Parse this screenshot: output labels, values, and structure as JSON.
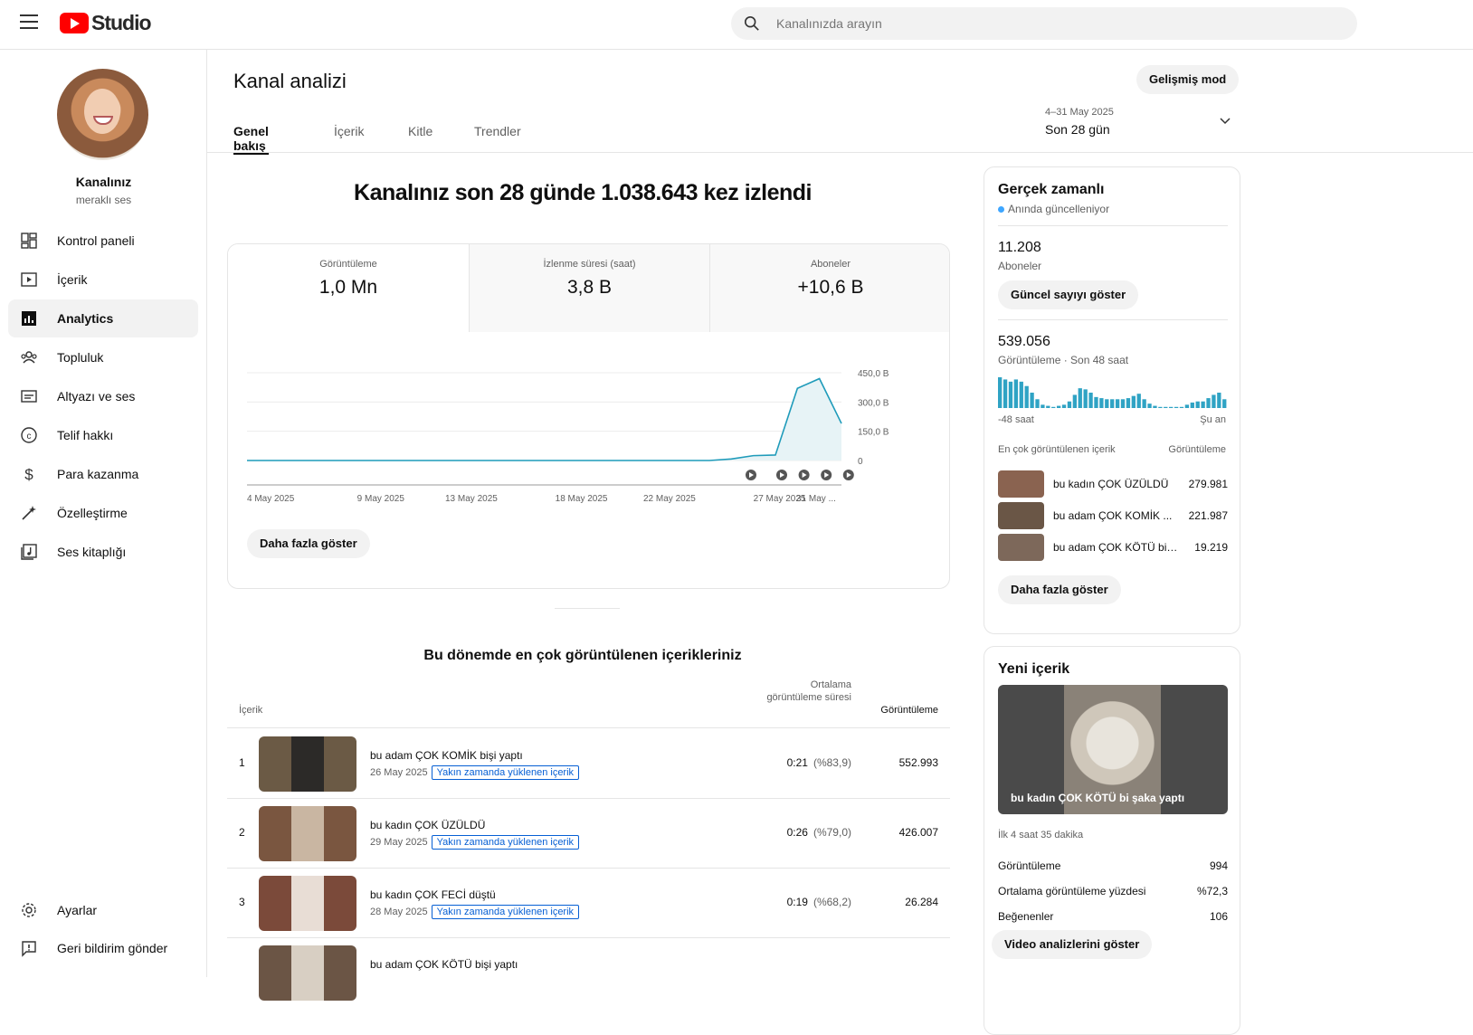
{
  "header": {
    "logo_text": "Studio",
    "search_placeholder": "Kanalınızda arayın"
  },
  "sidebar": {
    "channel_name": "Kanalınız",
    "channel_subtitle": "meraklı ses",
    "items": [
      {
        "label": "Kontrol paneli",
        "icon": "dashboard-icon"
      },
      {
        "label": "İçerik",
        "icon": "content-icon"
      },
      {
        "label": "Analytics",
        "icon": "analytics-icon"
      },
      {
        "label": "Topluluk",
        "icon": "community-icon"
      },
      {
        "label": "Altyazı ve ses",
        "icon": "subtitles-icon"
      },
      {
        "label": "Telif hakkı",
        "icon": "copyright-icon"
      },
      {
        "label": "Para kazanma",
        "icon": "dollar-icon"
      },
      {
        "label": "Özelleştirme",
        "icon": "magic-wand-icon"
      },
      {
        "label": "Ses kitaplığı",
        "icon": "audio-library-icon"
      }
    ],
    "bottom": [
      {
        "label": "Ayarlar",
        "icon": "gear-icon"
      },
      {
        "label": "Geri bildirim gönder",
        "icon": "feedback-icon"
      }
    ]
  },
  "main": {
    "title": "Kanal analizi",
    "advanced_mode": "Gelişmiş mod",
    "tabs": [
      "Genel bakış",
      "İçerik",
      "Kitle",
      "Trendler"
    ],
    "date_range": "4–31 May 2025",
    "date_label": "Son 28 gün",
    "headline": "Kanalınız son 28 günde 1.038.643 kez izlendi",
    "metrics": [
      {
        "label": "Görüntüleme",
        "value": "1,0 Mn"
      },
      {
        "label": "İzlenme süresi (saat)",
        "value": "3,8 B"
      },
      {
        "label": "Aboneler",
        "value": "+10,6 B"
      }
    ],
    "show_more": "Daha fazla göster",
    "top_content_title": "Bu dönemde en çok görüntülenen içerikleriniz",
    "table_headers": {
      "content": "İçerik",
      "avg_duration": "Ortalama görüntüleme süresi",
      "views": "Görüntüleme"
    },
    "rows": [
      {
        "rank": "1",
        "title": "bu adam ÇOK KOMİK bişi yaptı",
        "date": "26 May 2025",
        "badge": "Yakın zamanda yüklenen içerik",
        "avg": "0:21",
        "pct": "(%83,9)",
        "views": "552.993"
      },
      {
        "rank": "2",
        "title": "bu kadın ÇOK ÜZÜLDÜ",
        "date": "29 May 2025",
        "badge": "Yakın zamanda yüklenen içerik",
        "avg": "0:26",
        "pct": "(%79,0)",
        "views": "426.007"
      },
      {
        "rank": "3",
        "title": "bu kadın ÇOK FECİ düştü",
        "date": "28 May 2025",
        "badge": "Yakın zamanda yüklenen içerik",
        "avg": "0:19",
        "pct": "(%68,2)",
        "views": "26.284"
      },
      {
        "rank": "",
        "title": "bu adam ÇOK KÖTÜ bişi yaptı",
        "date": "",
        "badge": "",
        "avg": "",
        "pct": "",
        "views": ""
      }
    ]
  },
  "chart_data": {
    "type": "area",
    "x_labels": [
      "4 May 2025",
      "9 May 2025",
      "13 May 2025",
      "18 May 2025",
      "22 May 2025",
      "27 May 2025",
      "31 May ..."
    ],
    "y_ticks": [
      "450,0 B",
      "300,0 B",
      "150,0 B",
      "0"
    ],
    "ylim": [
      0,
      450000
    ],
    "values": [
      0,
      0,
      0,
      0,
      0,
      0,
      0,
      0,
      0,
      0,
      0,
      0,
      0,
      0,
      0,
      0,
      0,
      0,
      0,
      0,
      0,
      0,
      8000,
      25000,
      28000,
      370000,
      420000,
      190000
    ],
    "color": "#1f9bba",
    "shorts_markers": 5
  },
  "realtime": {
    "title": "Gerçek zamanlı",
    "subtitle": "Anında güncelleniyor",
    "subscribers": "11.208",
    "subscribers_label": "Aboneler",
    "show_count": "Güncel sayıyı göster",
    "views": "539.056",
    "views_label": "Görüntüleme · Son 48 saat",
    "axis_left": "-48 saat",
    "axis_right": "Şu an",
    "bars": [
      28,
      26,
      24,
      26,
      24,
      20,
      14,
      8,
      3,
      2,
      1,
      2,
      3,
      6,
      12,
      18,
      17,
      14,
      10,
      9,
      8,
      8,
      8,
      8,
      9,
      11,
      13,
      8,
      4,
      2,
      1,
      1,
      1,
      1,
      1,
      3,
      5,
      6,
      6,
      9,
      12,
      14,
      8
    ],
    "top_label": "En çok görüntülenen içerik",
    "top_value_label": "Görüntüleme",
    "top": [
      {
        "title": "bu kadın ÇOK ÜZÜLDÜ",
        "views": "279.981"
      },
      {
        "title": "bu adam ÇOK KOMİK ...",
        "views": "221.987"
      },
      {
        "title": "bu adam ÇOK KÖTÜ bişi...",
        "views": "19.219"
      }
    ],
    "show_more": "Daha fazla göster"
  },
  "new_content": {
    "title": "Yeni içerik",
    "video_title": "bu kadın ÇOK KÖTÜ bi şaka yaptı",
    "period": "İlk 4 saat 35 dakika",
    "stats": [
      {
        "label": "Görüntüleme",
        "value": "994"
      },
      {
        "label": "Ortalama görüntüleme yüzdesi",
        "value": "%72,3"
      },
      {
        "label": "Beğenenler",
        "value": "106"
      }
    ],
    "button": "Video analizlerini göster"
  }
}
